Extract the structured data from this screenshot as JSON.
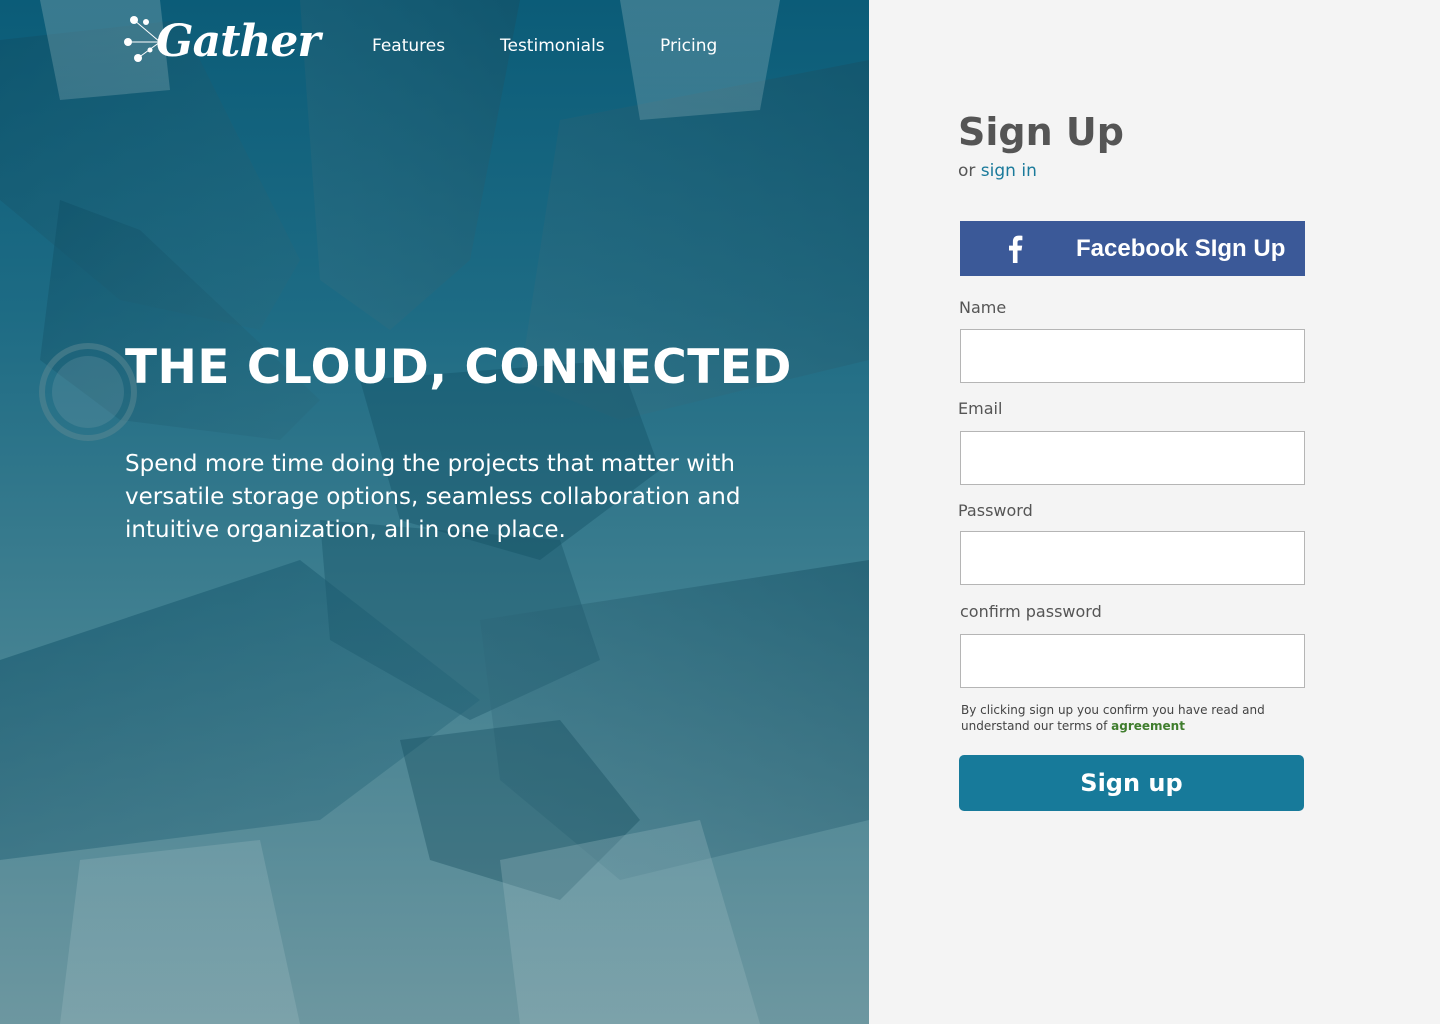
{
  "brand": {
    "name": "Gather",
    "logo_icon": "constellation-dots-icon"
  },
  "nav": {
    "items": [
      {
        "label": "Features"
      },
      {
        "label": "Testimonials"
      },
      {
        "label": "Pricing"
      }
    ]
  },
  "hero": {
    "headline": "THE CLOUD, CONNECTED",
    "lede": "Spend more time doing the projects that matter with versatile storage options, seamless collaboration and intuitive organization, all in one place."
  },
  "signup": {
    "title": "Sign Up",
    "alt_prefix": "or",
    "alt_link": "sign in",
    "facebook_label": "Facebook SIgn Up",
    "facebook_icon": "facebook-f-icon",
    "fields": {
      "name_label": "Name",
      "name_value": "",
      "email_label": "Email",
      "email_value": "",
      "password_label": "Password",
      "password_value": "",
      "confirm_label": "confirm password",
      "confirm_value": ""
    },
    "terms_text": "By clicking sign up you confirm you have read and understand our terms of",
    "terms_link": "agreement",
    "submit_label": "Sign up"
  },
  "colors": {
    "facebook": "#3b5998",
    "primary": "#177a9a",
    "link": "#1a7a9b",
    "agreement": "#3f7d2d",
    "panel_bg": "#f4f4f4",
    "hero_tint": "#1d6b84"
  }
}
